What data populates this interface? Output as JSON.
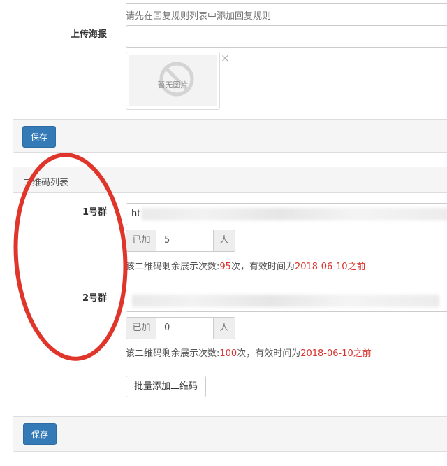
{
  "reply_hint": "请先在回复规则列表中添加回复规则",
  "poster": {
    "label": "上传海报",
    "no_image_text": "暂无图片",
    "close_glyph": "×"
  },
  "save_label": "保存",
  "qr_panel": {
    "title": "二维码列表",
    "groups": [
      {
        "label": "1号群",
        "url_prefix": "ht",
        "url_end": "",
        "addon_left": "已加",
        "count": "5",
        "addon_right": "人",
        "info_pre": "该二维码剩余展示次数:",
        "remaining": "95",
        "info_mid": "次，有效时间为",
        "expire": "2018-06-10之前"
      },
      {
        "label": "2号群",
        "url_prefix": "",
        "url_end": "",
        "addon_left": "已加",
        "count": "0",
        "addon_right": "人",
        "info_pre": "该二维码剩余展示次数:",
        "remaining": "100",
        "info_mid": "次，有效时间为",
        "expire": "2018-06-10之前"
      }
    ],
    "batch_add_label": "批量添加二维码"
  },
  "colors": {
    "primary": "#337ab7",
    "accent_red": "#d9312b",
    "annotation": "#e0352b"
  }
}
